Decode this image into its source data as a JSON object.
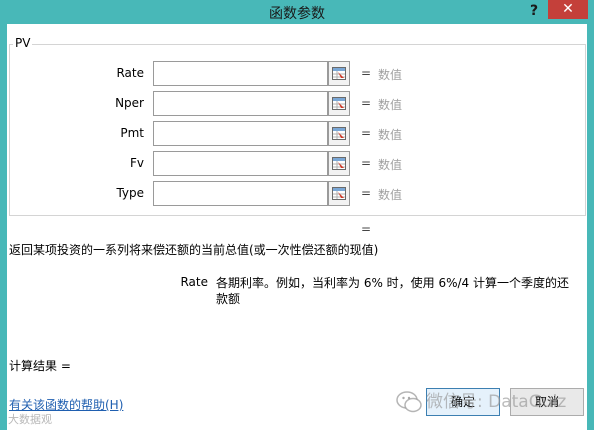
{
  "window": {
    "title": "函数参数",
    "help_glyph": "?",
    "close_glyph": "✕"
  },
  "function": {
    "name": "PV",
    "arguments": [
      {
        "label": "Rate",
        "value": "",
        "hint": "数值"
      },
      {
        "label": "Nper",
        "value": "",
        "hint": "数值"
      },
      {
        "label": "Pmt",
        "value": "",
        "hint": "数值"
      },
      {
        "label": "Fv",
        "value": "",
        "hint": "数值"
      },
      {
        "label": "Type",
        "value": "",
        "hint": "数值"
      }
    ],
    "equals_sign": "=",
    "result_equals": "=",
    "description": "返回某项投资的一系列将来偿还额的当前总值(或一次性偿还额的现值)",
    "arg_help_name": "Rate",
    "arg_help_text": "各期利率。例如，当利率为 6% 时，使用 6%/4 计算一个季度的还款额"
  },
  "footer": {
    "calc_result_label": "计算结果 =",
    "help_link": "有关该函数的帮助(H)",
    "ok_label": "确定",
    "cancel_label": "取消",
    "watermark_main": "微信号: DataGuiz",
    "watermark_small": "大数据观"
  },
  "colors": {
    "titlebar": "#48b8b8",
    "close_button": "#c4403a",
    "link": "#1f5fb0",
    "hint": "#a0a0a0"
  }
}
